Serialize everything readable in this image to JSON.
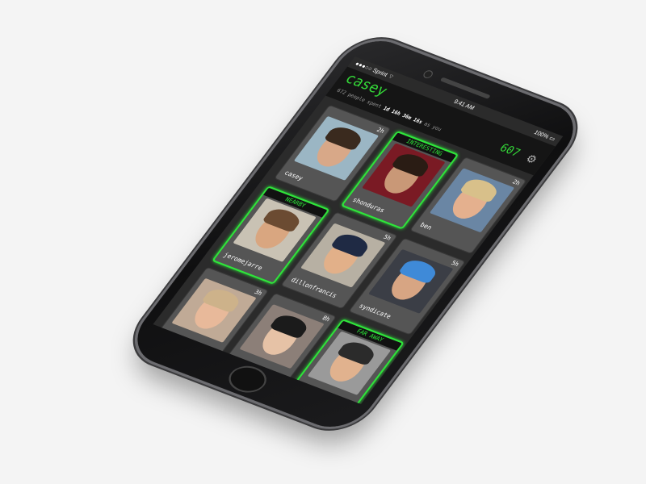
{
  "status": {
    "carrier": "●●●○○ Sprint ⌔",
    "time": "9:41 AM",
    "battery": "100% ▭"
  },
  "header": {
    "title": "casey",
    "count": "607",
    "sub_pre": "672 people spent ",
    "sub_duration": "1d 16h 36m 16s",
    "sub_post": " as you",
    "settings_icon": "gear-icon"
  },
  "cards": [
    {
      "name": "casey",
      "time": "2h",
      "tag": "",
      "bg": "#9bb6c4",
      "skin": "#d8a888",
      "hair": "#3a2a1e",
      "hl": false
    },
    {
      "name": "shonduras",
      "time": "",
      "tag": "INTERESTING",
      "bg": "#7a1a24",
      "skin": "#c99877",
      "hair": "#2a1c14",
      "hl": true
    },
    {
      "name": "ben",
      "time": "2h",
      "tag": "",
      "bg": "#6a86a4",
      "skin": "#e4b08e",
      "hair": "#d8c08a",
      "hl": false
    },
    {
      "name": "jeromejarre",
      "time": "",
      "tag": "NEARBY",
      "bg": "#c9c2b4",
      "skin": "#d9a680",
      "hair": "#6b4b32",
      "hl": true
    },
    {
      "name": "dillonfrancis",
      "time": "5h",
      "tag": "",
      "bg": "#b7b0a3",
      "skin": "#e2b089",
      "hair": "#1f2a44",
      "hl": false
    },
    {
      "name": "syndicate",
      "time": "5h",
      "tag": "",
      "bg": "#3b3e46",
      "skin": "#d7a583",
      "hair": "#3f8ad8",
      "hl": false
    },
    {
      "name": "",
      "time": "3h",
      "tag": "",
      "bg": "#c0aa96",
      "skin": "#e8b99a",
      "hair": "#cdb28a",
      "hl": false
    },
    {
      "name": "",
      "time": "8h",
      "tag": "",
      "bg": "#8c7f78",
      "skin": "#e6c2a6",
      "hair": "#1b1b1b",
      "hl": false
    },
    {
      "name": "",
      "time": "",
      "tag": "FAR AWAY",
      "bg": "#9a9a9a",
      "skin": "#e1b28e",
      "hair": "#2b2b2b",
      "hl": true
    }
  ]
}
